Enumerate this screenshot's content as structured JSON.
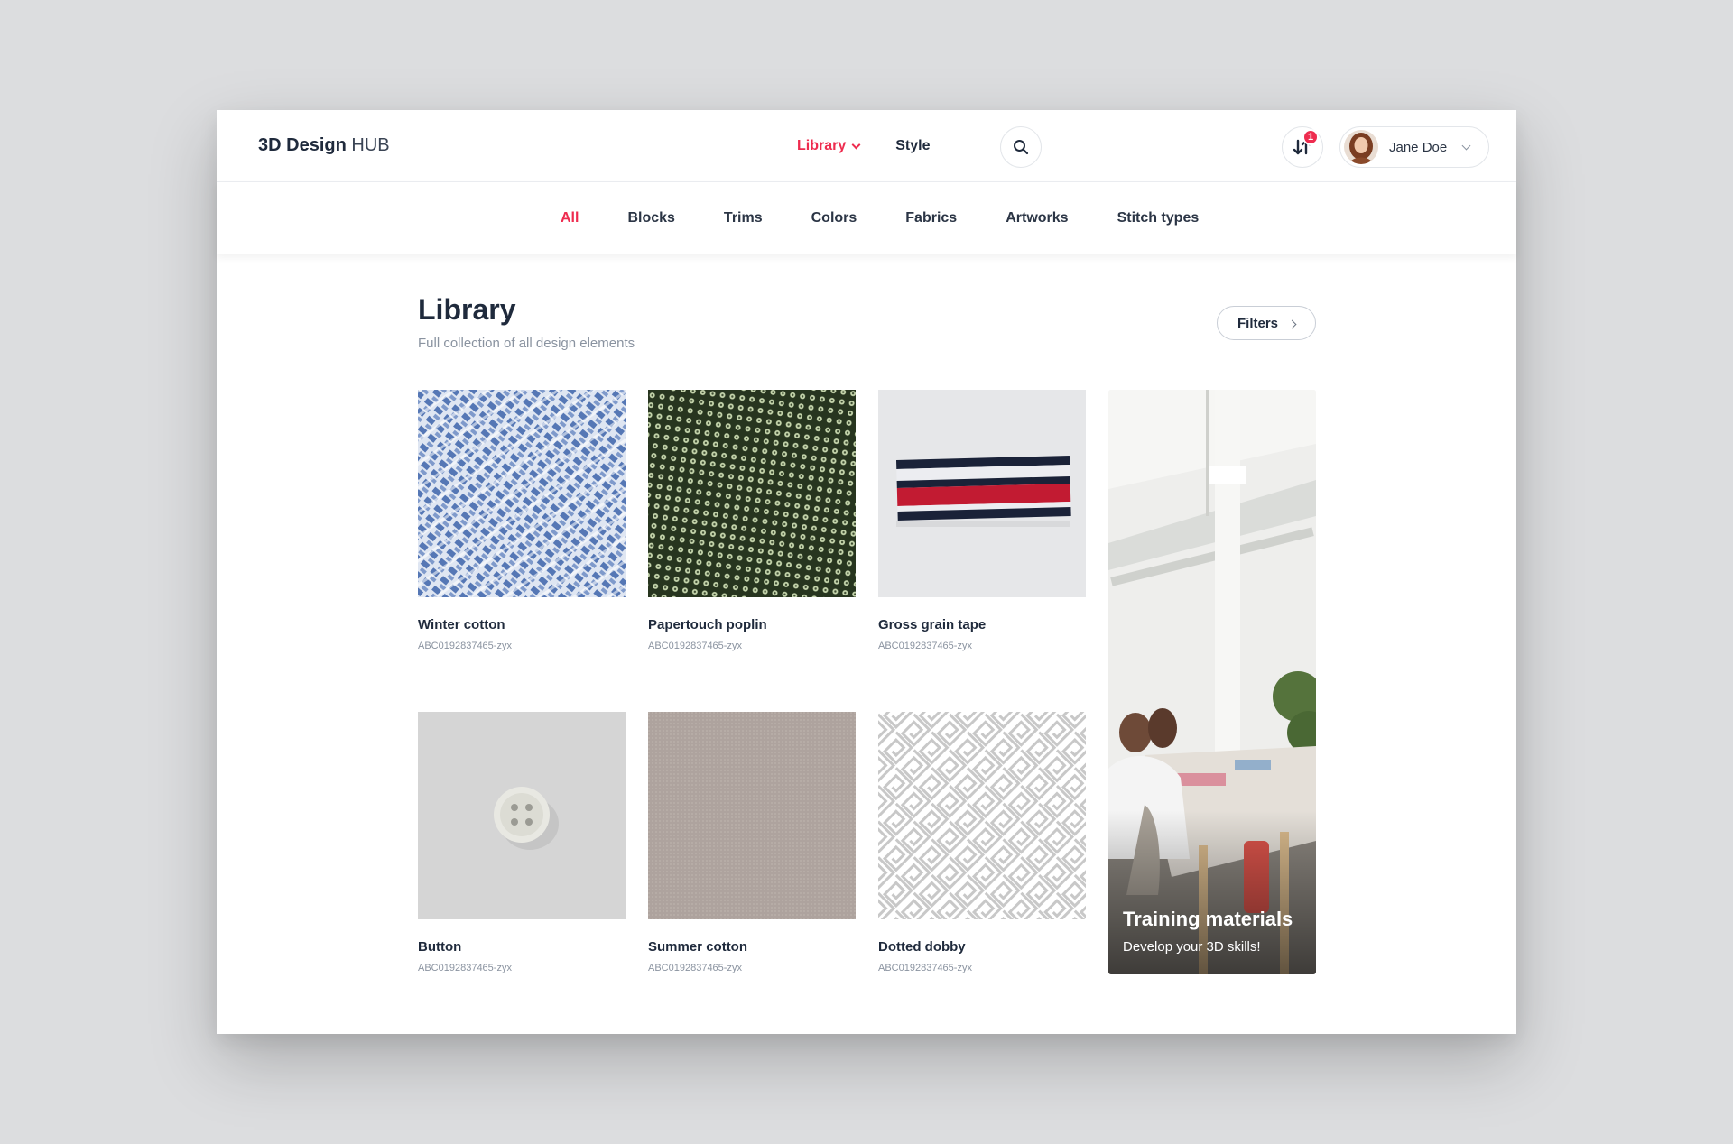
{
  "header": {
    "logo_bold": "3D Design",
    "logo_light": "HUB",
    "nav": [
      {
        "label": "Library",
        "active": true
      },
      {
        "label": "Style",
        "active": false
      }
    ],
    "notification_count": "1",
    "user_name": "Jane Doe"
  },
  "subnav": {
    "items": [
      "All",
      "Blocks",
      "Trims",
      "Colors",
      "Fabrics",
      "Artworks",
      "Stitch types"
    ],
    "active": "All"
  },
  "page": {
    "title": "Library",
    "subtitle": "Full collection of all design elements",
    "filters_label": "Filters"
  },
  "items": [
    {
      "name": "Winter cotton",
      "code": "ABC0192837465-zyx"
    },
    {
      "name": "Papertouch poplin",
      "code": "ABC0192837465-zyx"
    },
    {
      "name": "Gross grain tape",
      "code": "ABC0192837465-zyx"
    },
    {
      "name": "Button",
      "code": "ABC0192837465-zyx"
    },
    {
      "name": "Summer cotton",
      "code": "ABC0192837465-zyx"
    },
    {
      "name": "Dotted dobby",
      "code": "ABC0192837465-zyx"
    }
  ],
  "promo": {
    "title": "Training materials",
    "subtitle": "Develop your 3D skills!"
  },
  "colors": {
    "accent": "#ee2c4f",
    "text": "#1f2a3c",
    "muted": "#8a93a0"
  }
}
